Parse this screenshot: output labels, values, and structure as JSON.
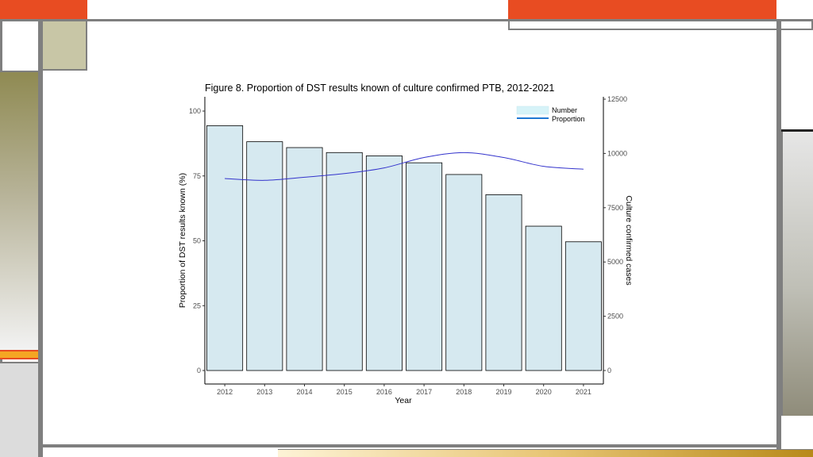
{
  "slide": {
    "colors": {
      "accent_orange": "#e84c22",
      "frame_gray": "#7f7f7f",
      "olive": "#8f8a52",
      "khaki": "#c8c6a6",
      "light_gray": "#dcdcdc",
      "gold": "#c8a032",
      "bar_fill": "#d6e9f0",
      "line_color": "#3333cc",
      "legend_line": "#1f78d4"
    }
  },
  "chart_data": {
    "type": "bar",
    "title": "Figure 8. Proportion of DST results known of culture confirmed PTB, 2012-2021",
    "xlabel": "Year",
    "ylabel": "Proportion of DST results known (%)",
    "y2label": "Culture confirmed cases",
    "categories": [
      "2012",
      "2013",
      "2014",
      "2015",
      "2016",
      "2017",
      "2018",
      "2019",
      "2020",
      "2021"
    ],
    "series": [
      {
        "name": "Number",
        "type": "bar",
        "axis": "right",
        "values": [
          11280,
          10540,
          10270,
          10040,
          9890,
          9570,
          9030,
          8100,
          6650,
          5930
        ]
      },
      {
        "name": "Proportion",
        "type": "line",
        "axis": "left",
        "values": [
          74.0,
          73.3,
          74.5,
          75.9,
          78.1,
          82.1,
          84.0,
          82.1,
          78.7,
          77.6
        ]
      }
    ],
    "ylim": [
      0,
      100
    ],
    "y2lim": [
      0,
      12500
    ],
    "yticks": [
      "0",
      "25",
      "50",
      "75",
      "100"
    ],
    "y2ticks": [
      "0",
      "2500",
      "5000",
      "7500",
      "10000",
      "12500"
    ],
    "legend": {
      "entries": [
        "Number",
        "Proportion"
      ],
      "position": "top-right"
    },
    "grid": false
  }
}
